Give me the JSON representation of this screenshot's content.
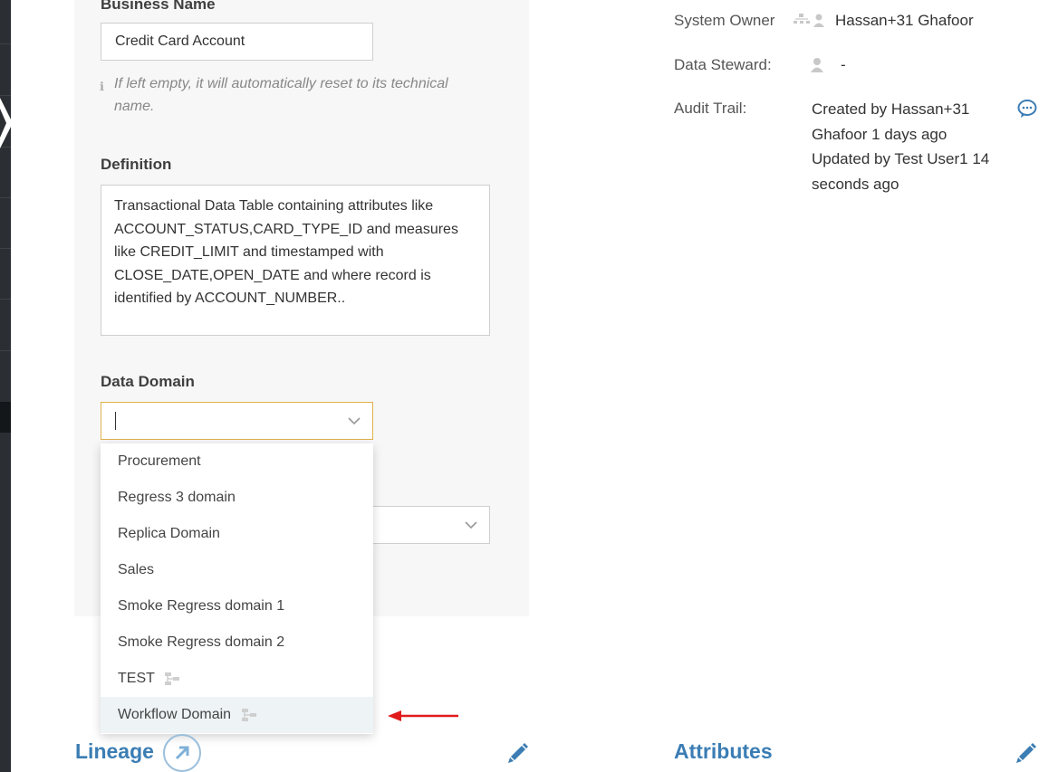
{
  "form": {
    "business_name_label": "Business Name",
    "business_name_value": "Credit Card Account",
    "business_name_hint": "If left empty, it will automatically reset to its technical name.",
    "definition_label": "Definition",
    "definition_value": "Transactional Data Table containing attributes like ACCOUNT_STATUS,CARD_TYPE_ID and measures like CREDIT_LIMIT and timestamped with CLOSE_DATE,OPEN_DATE and where record is identified by ACCOUNT_NUMBER..",
    "data_domain_label": "Data Domain",
    "data_domain_value": ""
  },
  "dropdown": {
    "options": [
      {
        "label": "Procurement"
      },
      {
        "label": "Regress 3 domain"
      },
      {
        "label": "Replica Domain"
      },
      {
        "label": "Sales"
      },
      {
        "label": "Smoke Regress domain 1"
      },
      {
        "label": "Smoke Regress domain 2"
      },
      {
        "label": "TEST",
        "icon": "workflow-icon"
      },
      {
        "label": "Workflow Domain",
        "icon": "workflow-icon",
        "highlighted": true
      }
    ]
  },
  "meta": {
    "system_owner_label": "System Owner",
    "system_owner_value": "Hassan+31 Ghafoor",
    "data_steward_label": "Data Steward:",
    "data_steward_value": "-",
    "audit_label": "Audit Trail:",
    "audit_created": "Created by Hassan+31 Ghafoor 1 days ago",
    "audit_updated": "Updated by Test User1 14 seconds ago"
  },
  "sections": {
    "lineage_title": "Lineage",
    "attributes_title": "Attributes"
  },
  "colors": {
    "accent": "#3b7db4",
    "focus_border": "#e0b24c",
    "annotation_arrow": "#e11b1b"
  }
}
